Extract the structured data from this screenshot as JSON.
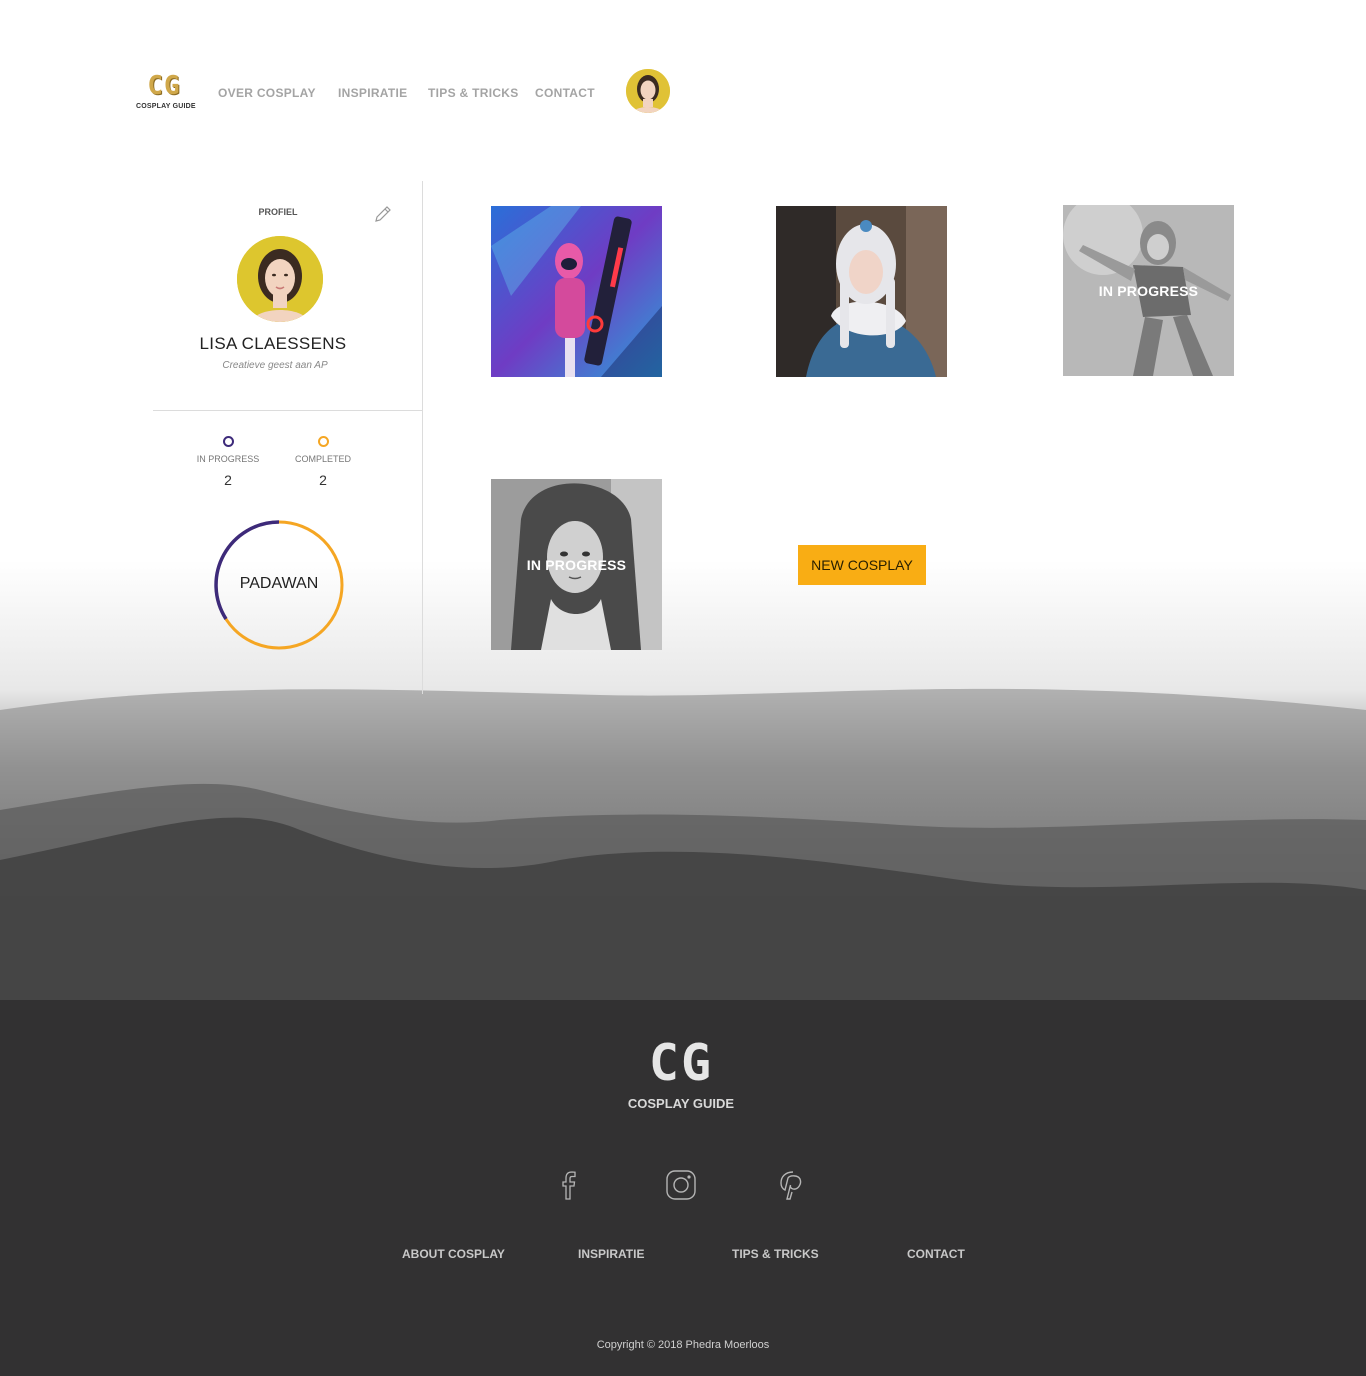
{
  "header": {
    "logo_mark": "CG",
    "logo_sub": "COSPLAY GUIDE",
    "nav": [
      "OVER COSPLAY",
      "INSPIRATIE",
      "TIPS & TRICKS",
      "CONTACT"
    ]
  },
  "profile": {
    "section_label": "PROFIEL",
    "name": "LISA CLAESSENS",
    "tagline": "Creatieve geest aan AP",
    "stats": [
      {
        "label": "IN PROGRESS",
        "value": "2",
        "color": "#3d2a7a"
      },
      {
        "label": "COMPLETED",
        "value": "2",
        "color": "#f5a623"
      }
    ],
    "rank": "PADAWAN"
  },
  "gallery": {
    "tiles": [
      {
        "status": ""
      },
      {
        "status": ""
      },
      {
        "status": "IN PROGRESS"
      },
      {
        "status": "IN PROGRESS"
      }
    ],
    "new_button": "NEW COSPLAY"
  },
  "footer": {
    "logo_mark": "CG",
    "logo_sub": "COSPLAY GUIDE",
    "social_icons": [
      "facebook-icon",
      "instagram-icon",
      "pinterest-icon"
    ],
    "links": [
      "ABOUT COSPLAY",
      "INSPIRATIE",
      "TIPS & TRICKS",
      "CONTACT"
    ],
    "copyright": "Copyright © 2018 Phedra Moerloos"
  },
  "colors": {
    "accent": "#f9ad14",
    "progress": "#3d2a7a",
    "footer_bg": "#323132"
  }
}
